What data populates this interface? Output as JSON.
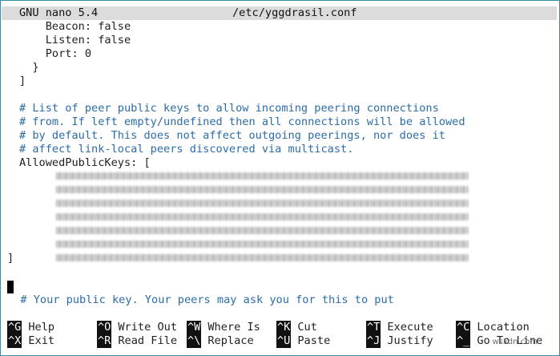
{
  "titlebar": {
    "app": "GNU nano 5.4",
    "file": "/etc/yggdrasil.conf"
  },
  "lines": [
    "    Beacon: false",
    "    Listen: false",
    "    Port: 0",
    "  }",
    "]",
    "",
    "# List of peer public keys to allow incoming peering connections",
    "# from. If left empty/undefined then all connections will be allowed",
    "# by default. This does not affect outgoing peerings, nor does it",
    "# affect link-local peers discovered via multicast.",
    "AllowedPublicKeys: [",
    "]",
    "",
    "  # Your public key. Your peers may ask you for this to put"
  ],
  "shortcuts": [
    {
      "key": "^G",
      "label": "Help"
    },
    {
      "key": "^X",
      "label": "Exit"
    },
    {
      "key": "^O",
      "label": "Write Out"
    },
    {
      "key": "^R",
      "label": "Read File"
    },
    {
      "key": "^W",
      "label": "Where Is"
    },
    {
      "key": "^\\",
      "label": "Replace"
    },
    {
      "key": "^K",
      "label": "Cut"
    },
    {
      "key": "^U",
      "label": "Paste"
    },
    {
      "key": "^T",
      "label": "Execute"
    },
    {
      "key": "^J",
      "label": "Justify"
    },
    {
      "key": "^C",
      "label": "Location"
    },
    {
      "key": "^_",
      "label": "Go To Line"
    }
  ],
  "watermark": "wsxdn.com",
  "colors": {
    "comment": "#2b6ca8",
    "titlebar_bg": "#dcdcdc",
    "frame": "#2f8fa8"
  }
}
